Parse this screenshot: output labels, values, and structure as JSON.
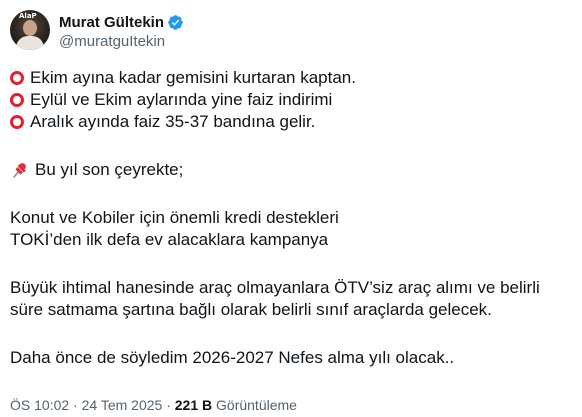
{
  "author": {
    "display_name": "Murat Gültekin",
    "handle": "@muratguItekin",
    "verified_icon": "verified-badge-icon",
    "avatar_text": "AlaP"
  },
  "tweet": {
    "bullets": [
      {
        "icon": "red-circle-icon",
        "text": "Ekim ayına kadar gemisini kurtaran kaptan."
      },
      {
        "icon": "red-circle-icon",
        "text": "Eylül ve Ekim aylarında yine faiz indirimi"
      },
      {
        "icon": "red-circle-icon",
        "text": "Aralık ayında faiz 35-37 bandına gelir."
      }
    ],
    "pin_line": {
      "icon": "pushpin-icon",
      "text": "Bu yıl son çeyrekte;"
    },
    "lines": [
      "Konut ve Kobiler için önemli kredi destekleri",
      "TOKİ’den ilk defa ev alacaklara kampanya",
      "Büyük ihtimal hanesinde araç olmayanlara ÖTV’siz araç alımı ve belirli",
      "süre satmama şartına bağlı olarak belirli sınıf araçlarda gelecek.",
      "Daha önce de söyledim 2026-2027 Nefes alma yılı olacak.."
    ]
  },
  "meta": {
    "time": "ÖS 10:02",
    "separator": "·",
    "date": "24 Tem 2025",
    "views_count": "221 B",
    "views_label": "Görüntüleme"
  },
  "colors": {
    "text": "#0f1419",
    "secondary": "#536471",
    "verified": "#1d9bf0",
    "ring": "#e0242f"
  }
}
